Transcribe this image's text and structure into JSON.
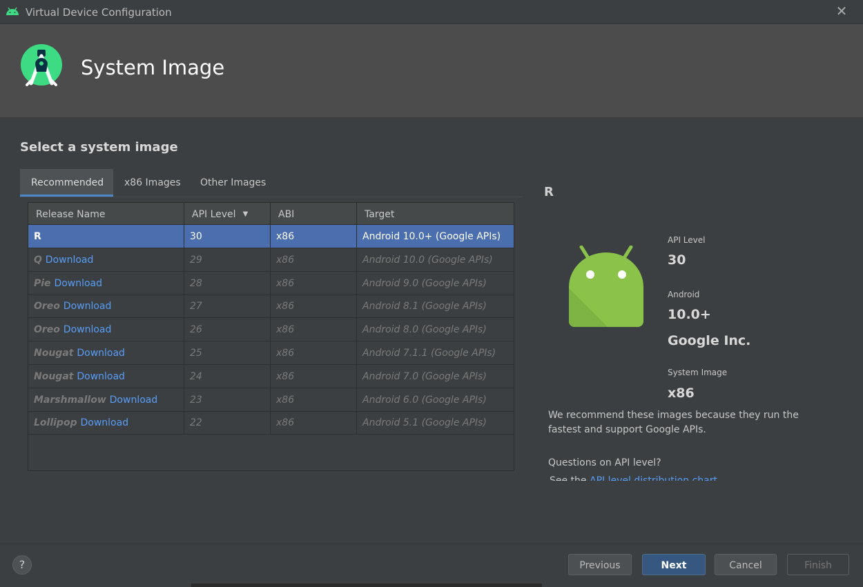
{
  "window": {
    "title": "Virtual Device Configuration"
  },
  "header": {
    "title": "System Image"
  },
  "section_title": "Select a system image",
  "tabs": [
    {
      "label": "Recommended",
      "active": true
    },
    {
      "label": "x86 Images",
      "active": false
    },
    {
      "label": "Other Images",
      "active": false
    }
  ],
  "table": {
    "columns": [
      "Release Name",
      "API Level",
      "ABI",
      "Target"
    ],
    "sort_icon": "sort-desc-icon",
    "rows": [
      {
        "name": "R",
        "download": "",
        "api": "30",
        "abi": "x86",
        "target": "Android 10.0+ (Google APIs)",
        "selected": true
      },
      {
        "name": "Q",
        "download": "Download",
        "api": "29",
        "abi": "x86",
        "target": "Android 10.0 (Google APIs)"
      },
      {
        "name": "Pie",
        "download": "Download",
        "api": "28",
        "abi": "x86",
        "target": "Android 9.0 (Google APIs)"
      },
      {
        "name": "Oreo",
        "download": "Download",
        "api": "27",
        "abi": "x86",
        "target": "Android 8.1 (Google APIs)"
      },
      {
        "name": "Oreo",
        "download": "Download",
        "api": "26",
        "abi": "x86",
        "target": "Android 8.0 (Google APIs)"
      },
      {
        "name": "Nougat",
        "download": "Download",
        "api": "25",
        "abi": "x86",
        "target": "Android 7.1.1 (Google APIs)"
      },
      {
        "name": "Nougat",
        "download": "Download",
        "api": "24",
        "abi": "x86",
        "target": "Android 7.0 (Google APIs)"
      },
      {
        "name": "Marshmallow",
        "download": "Download",
        "api": "23",
        "abi": "x86",
        "target": "Android 6.0 (Google APIs)"
      },
      {
        "name": "Lollipop",
        "download": "Download",
        "api": "22",
        "abi": "x86",
        "target": "Android 5.1 (Google APIs)"
      }
    ]
  },
  "details": {
    "title": "R",
    "api_label": "API Level",
    "api_value": "30",
    "android_label": "Android",
    "android_value": "10.0+",
    "vendor": "Google Inc.",
    "sysimg_label": "System Image",
    "sysimg_value": "x86",
    "description": "We recommend these images because they run the fastest and support Google APIs.",
    "question": "Questions on API level?",
    "see_prefix": "See the ",
    "see_link": "API level distribution chart"
  },
  "footer": {
    "help": "?",
    "previous": "Previous",
    "next": "Next",
    "cancel": "Cancel",
    "finish": "Finish"
  },
  "colors": {
    "accent": "#4a88c7",
    "selection": "#4b6eaf",
    "link": "#589df6",
    "android_green": "#8bc34a"
  }
}
